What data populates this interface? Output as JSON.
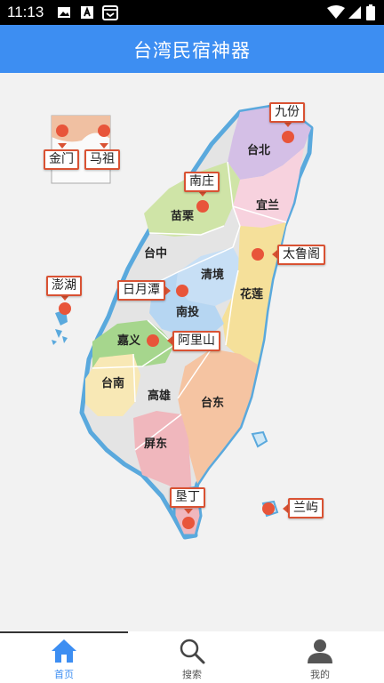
{
  "status_bar": {
    "time": "11:13"
  },
  "app": {
    "title": "台湾民宿神器"
  },
  "regions": [
    {
      "id": "taibei",
      "name": "台北"
    },
    {
      "id": "yilan",
      "name": "宜兰"
    },
    {
      "id": "miaoli",
      "name": "苗栗"
    },
    {
      "id": "taizhong",
      "name": "台中"
    },
    {
      "id": "qingjing",
      "name": "清境"
    },
    {
      "id": "hualian",
      "name": "花莲"
    },
    {
      "id": "nantou",
      "name": "南投"
    },
    {
      "id": "jiayi",
      "name": "嘉义"
    },
    {
      "id": "tainan",
      "name": "台南"
    },
    {
      "id": "gaoxiong",
      "name": "高雄"
    },
    {
      "id": "taidong",
      "name": "台东"
    },
    {
      "id": "pingdong",
      "name": "屏东"
    }
  ],
  "markers": [
    {
      "id": "jiufen",
      "label": "九份"
    },
    {
      "id": "jinmen",
      "label": "金门"
    },
    {
      "id": "mazu",
      "label": "马祖"
    },
    {
      "id": "nanzhuang",
      "label": "南庄"
    },
    {
      "id": "tailuge",
      "label": "太鲁阁"
    },
    {
      "id": "penghu",
      "label": "澎湖"
    },
    {
      "id": "riyuetan",
      "label": "日月潭"
    },
    {
      "id": "alishan",
      "label": "阿里山"
    },
    {
      "id": "kending",
      "label": "垦丁"
    },
    {
      "id": "lanyu",
      "label": "兰屿"
    }
  ],
  "tabs": [
    {
      "id": "home",
      "label": "首页",
      "icon": "home-icon",
      "active": true
    },
    {
      "id": "search",
      "label": "搜索",
      "icon": "search-icon",
      "active": false
    },
    {
      "id": "mine",
      "label": "我的",
      "icon": "user-icon",
      "active": false
    }
  ],
  "colors": {
    "app_bar": "#3d8ef2",
    "marker_border": "#d95233",
    "pin": "#e8553a",
    "tab_active": "#3d8ef2",
    "coast": "#5aa9dd",
    "taibei": "#d4bfe6",
    "yilan": "#f7d2de",
    "miaoli": "#cfe4a7",
    "taizhong": "#e4e4e4",
    "qingjing": "#c7dff5",
    "hualian": "#f5e09a",
    "nantou": "#b6d6f2",
    "jiayi": "#a6d68d",
    "tainan": "#f8e8b5",
    "gaoxiong": "#e3e3e3",
    "taidong": "#f5c4a2",
    "pingdong": "#f0b7bd"
  }
}
